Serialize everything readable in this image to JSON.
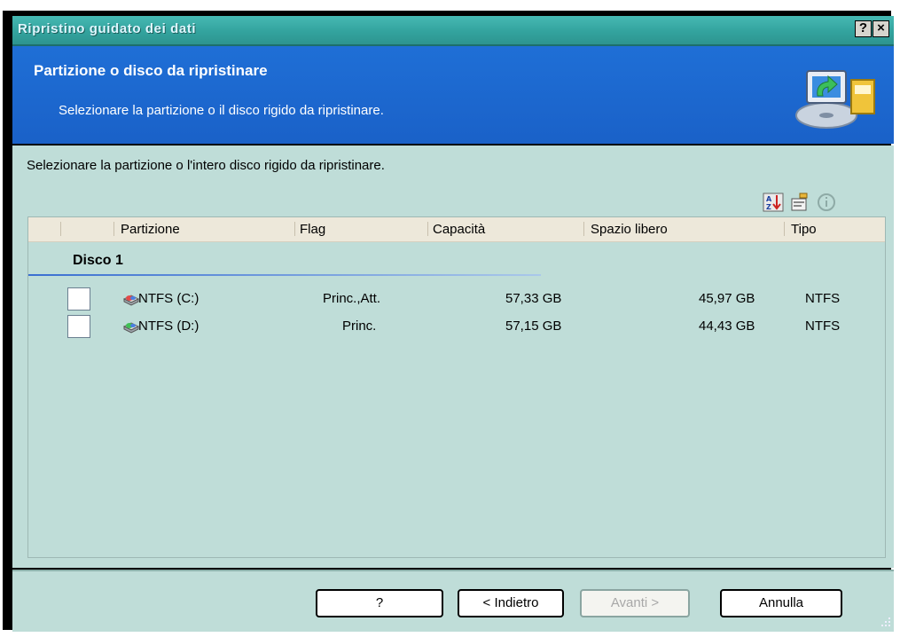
{
  "window": {
    "title": "Ripristino guidato dei dati",
    "help_button": "?",
    "close_button": "×"
  },
  "header": {
    "title": "Partizione o disco da ripristinare",
    "subtitle": "Selezionare la partizione o il disco rigido da ripristinare."
  },
  "content": {
    "instruction": "Selezionare la partizione o l'intero disco rigido da ripristinare.",
    "toolbar_icons": [
      "sort-icon",
      "properties-icon",
      "info-icon"
    ]
  },
  "listview": {
    "columns": [
      "Partizione",
      "Flag",
      "Capacità",
      "Spazio libero",
      "Tipo"
    ],
    "group": "Disco 1",
    "rows": [
      {
        "partition": "NTFS (C:)",
        "flag": "Princ.,Att.",
        "capacity": "57,33 GB",
        "free_space": "45,97 GB",
        "type": "NTFS",
        "checked": false
      },
      {
        "partition": "NTFS (D:)",
        "flag": "Princ.",
        "capacity": "57,15 GB",
        "free_space": "44,43 GB",
        "type": "NTFS",
        "checked": false
      }
    ]
  },
  "footer": {
    "help_label": "?",
    "back_label": "< Indietro",
    "next_label": "Avanti >",
    "cancel_label": "Annulla"
  },
  "colors": {
    "titlebar": "#33a39e",
    "header": "#1a61c8",
    "content_bg": "#bfddd8"
  }
}
